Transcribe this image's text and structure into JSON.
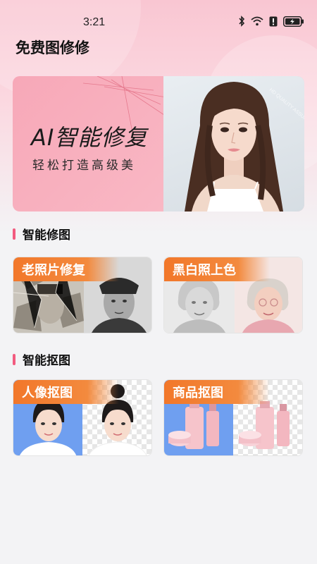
{
  "status_bar": {
    "time": "3:21",
    "icons": [
      "bluetooth-icon",
      "wifi-icon",
      "alert-icon",
      "battery-charging-icon"
    ]
  },
  "page": {
    "title": "免费图修修"
  },
  "banner": {
    "title": "AI智能修复",
    "subtitle": "轻松打造高级美",
    "watermark": "HD QUALITY ASSURANCE"
  },
  "sections": [
    {
      "title": "智能修图",
      "cards": [
        {
          "label": "老照片修复"
        },
        {
          "label": "黑白照上色"
        }
      ]
    },
    {
      "title": "智能抠图",
      "cards": [
        {
          "label": "人像抠图"
        },
        {
          "label": "商品抠图"
        }
      ]
    }
  ],
  "colors": {
    "accent_orange": "#f2772a",
    "section_marker": "#f25b7f",
    "header_pink": "#f9c6d2",
    "portrait_blue": "#6f9ff0"
  }
}
